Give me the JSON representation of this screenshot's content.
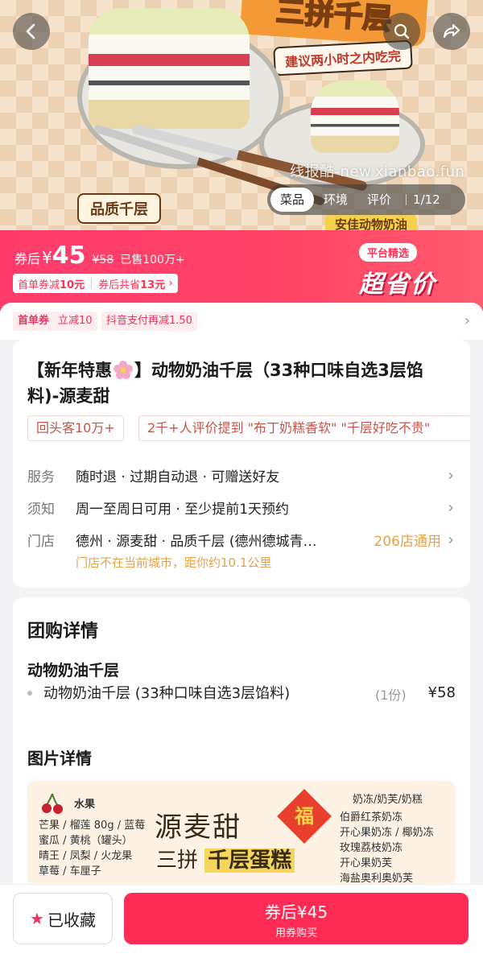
{
  "hero": {
    "banner_text": "三拼千层",
    "note_text": "建议两小时之内吃完",
    "tag_left": "品质千层",
    "tag_right": "安佳动物奶油",
    "watermark": "线报酷-new.xianbao.fun",
    "gallery_tabs": [
      "菜品",
      "环境",
      "评价"
    ],
    "gallery_active": "菜品",
    "gallery_count": "1/12"
  },
  "price": {
    "prefix": "券后",
    "currency": "¥",
    "amount": "45",
    "original": "¥58",
    "sold": "已售100万+",
    "coupon_first_label": "首单券减",
    "coupon_first_value": "10元",
    "coupon_save_label": "券后共省",
    "coupon_save_value": "13元",
    "badge_pick": "平台精选",
    "badge_super": "超省价"
  },
  "coupon_strip": {
    "tags": [
      "首单券",
      "立减10",
      "抖音支付再减1.50"
    ]
  },
  "product": {
    "title_prefix": "【新年特惠",
    "title_suffix": "】动物奶油千层（33种口味自选3层馅料)-源麦甜",
    "chips": [
      "回头客10万+",
      "2千+人评价提到 \"布丁奶糕香软\" \"千层好吃不贵\""
    ],
    "service_label": "服务",
    "service_value": "随时退 · 过期自动退 · 可赠送好友",
    "notice_label": "须知",
    "notice_value": "周一至周日可用 · 至少提前1天预约",
    "store_label": "门店",
    "store_value": "德州 · 源麦甜 · 品质千层 (德州德城青…",
    "store_link": "206店通用",
    "store_note": "门店不在当前城市，距你约10.1公里"
  },
  "detail": {
    "section_title": "团购详情",
    "group_title": "动物奶油千层",
    "item_name": "动物奶油千层 (33种口味自选3层馅料)",
    "item_qty": "(1份)",
    "item_price": "¥58",
    "images_title": "图片详情",
    "poster": {
      "fruit_title": "水果",
      "fruit_lines": [
        "芒果 / 榴莲 80g / 蓝莓",
        "蜜瓜 / 黄桃（罐头）",
        "晴王 / 凤梨 / 火龙果",
        "草莓 / 车厘子"
      ],
      "brand": "源麦甜",
      "sub_prefix": "三拼",
      "sub_bold": "千层蛋糕",
      "fu": "福",
      "right_title": "奶冻/奶芙/奶糕",
      "right_lines": [
        "伯爵红茶奶冻",
        "开心果奶冻 / 椰奶冻",
        "玫瑰荔枝奶冻",
        "开心果奶芙",
        "海盐奥利奥奶芙"
      ]
    }
  },
  "bottom": {
    "fav_label": "已收藏",
    "buy_label": "券后¥45",
    "buy_sub": "用券购买"
  },
  "colors": {
    "accent": "#fe2c55",
    "price_bar": "#ff3b6b",
    "gold_text": "#e9a14a"
  }
}
